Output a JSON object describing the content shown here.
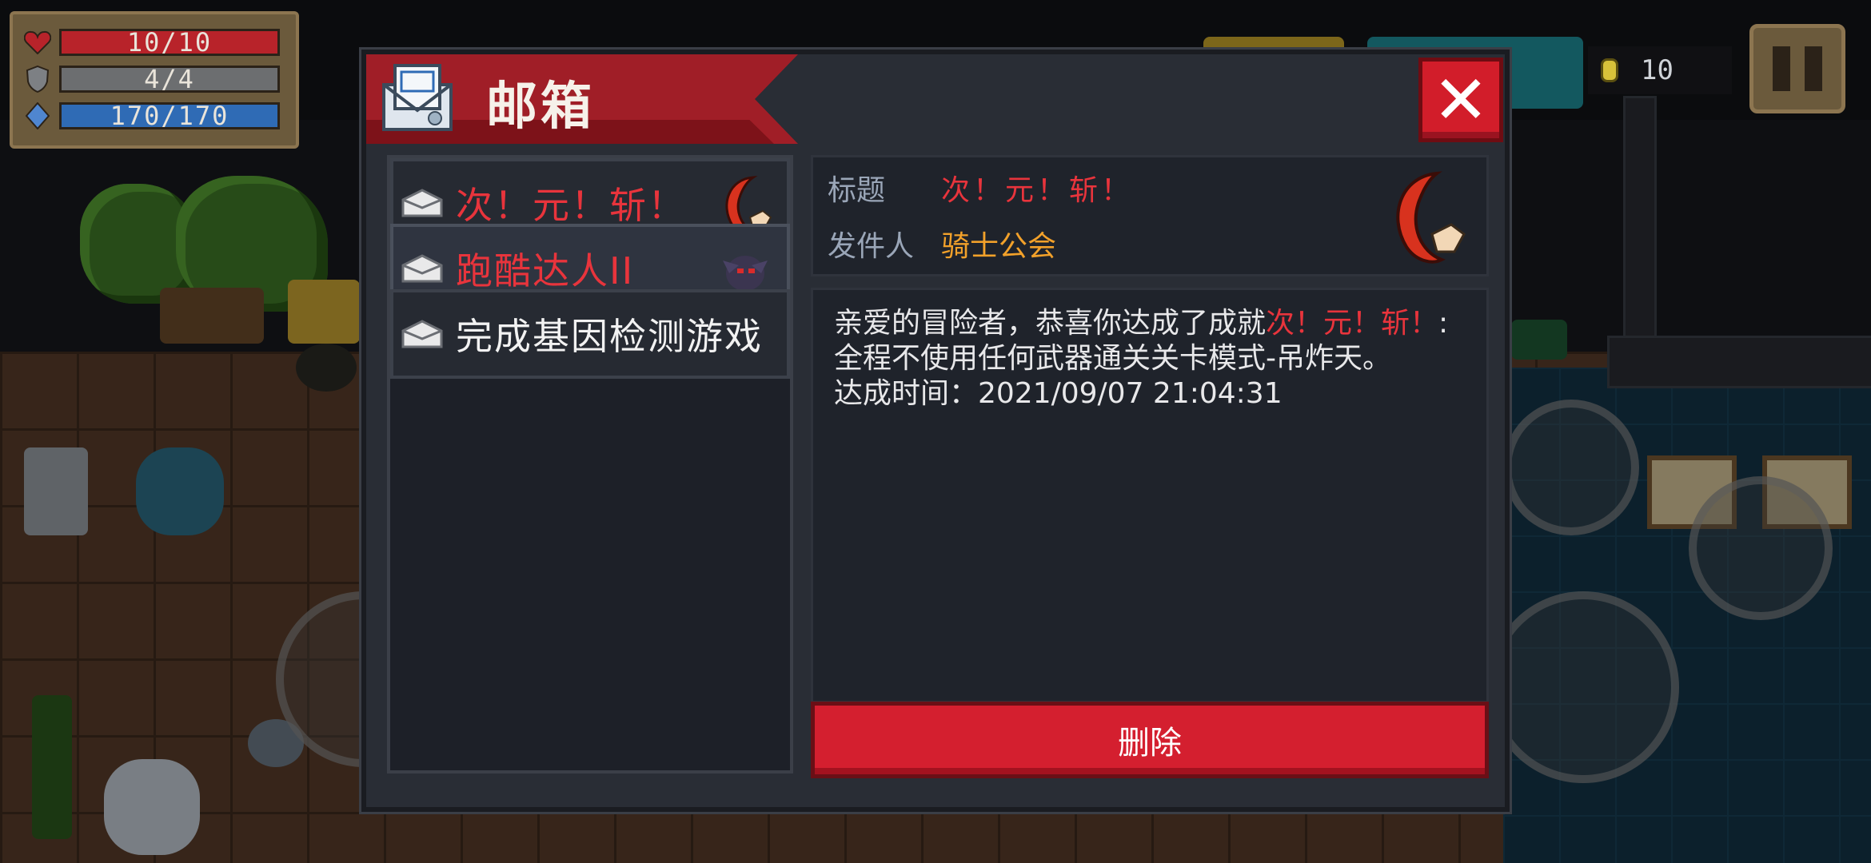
{
  "hud": {
    "health": {
      "text": "10/10",
      "icon": "heart-icon",
      "color": "#b8232a"
    },
    "armor": {
      "text": "4/4",
      "icon": "shield-icon",
      "color": "#6c6e70"
    },
    "energy": {
      "text": "170/170",
      "icon": "diamond-icon",
      "color": "#2f6bb5"
    },
    "coins": {
      "value": "10",
      "icon": "coin-icon"
    },
    "pause": {
      "icon": "pause-icon"
    }
  },
  "mailbox": {
    "title": "邮箱",
    "close_icon": "close-icon",
    "list": [
      {
        "label": "次！元！斩！",
        "color": "#e8343c",
        "thumb": "crescent-blade-icon"
      },
      {
        "label": "跑酷达人II",
        "color": "#e8343c",
        "thumb": "shadow-creature-icon"
      },
      {
        "label": "完成基因检测游戏",
        "color": "#f2f2f2",
        "thumb": ""
      }
    ],
    "detail": {
      "title_label": "标题",
      "title_value": "次！元！斩！",
      "sender_label": "发件人",
      "sender_value": "骑士公会",
      "body_prefix": "亲爱的冒险者，恭喜你达成了成就",
      "body_highlight": "次！元！斩！",
      "body_suffix": ":全程不使用任何武器通关关卡模式-吊炸天。",
      "achieved_line": "达成时间：2021/09/07 21:04:31"
    },
    "delete_label": "删除"
  },
  "colors": {
    "red_text": "#e8343c",
    "orange_text": "#f2a12a",
    "panel": "#292d35",
    "button_red": "#d41f2f"
  }
}
